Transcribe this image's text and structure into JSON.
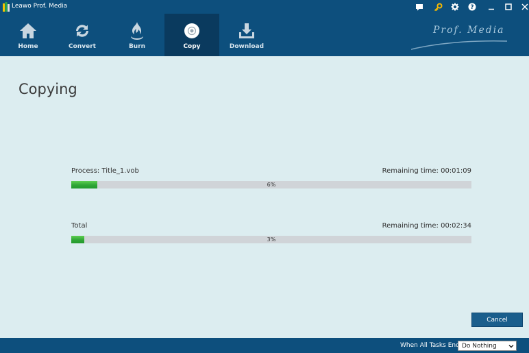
{
  "window": {
    "title": "Leawo Prof. Media"
  },
  "titlebar_icons": [
    "chat-icon",
    "key-icon",
    "settings-icon",
    "help-icon",
    "minimize-icon",
    "maximize-icon",
    "close-icon"
  ],
  "nav": {
    "items": [
      {
        "label": "Home",
        "icon": "home-icon"
      },
      {
        "label": "Convert",
        "icon": "convert-icon"
      },
      {
        "label": "Burn",
        "icon": "burn-icon"
      },
      {
        "label": "Copy",
        "icon": "copy-disc-icon",
        "active": true
      },
      {
        "label": "Download",
        "icon": "download-icon"
      }
    ],
    "brand": "Prof. Media"
  },
  "main": {
    "title": "Copying",
    "tasks": [
      {
        "label": "Process:  Title_1.vob",
        "remaining": "Remaining time:  00:01:09",
        "progress": 0.065,
        "percent_text": "6%"
      },
      {
        "label": "Total",
        "remaining": "Remaining time:  00:02:34",
        "progress": 0.033,
        "percent_text": "3%"
      }
    ],
    "cancel_label": "Cancel"
  },
  "footer": {
    "label": "When All Tasks End:",
    "select_value": "Do Nothing"
  },
  "colors": {
    "header_bg": "#0d4f7d",
    "active_tab_bg": "#0a3a5e",
    "content_bg": "#dcedf0",
    "progress_green": "#2fa636",
    "progress_track": "#d0d4d8",
    "cancel_bg": "#1a5e8c"
  }
}
